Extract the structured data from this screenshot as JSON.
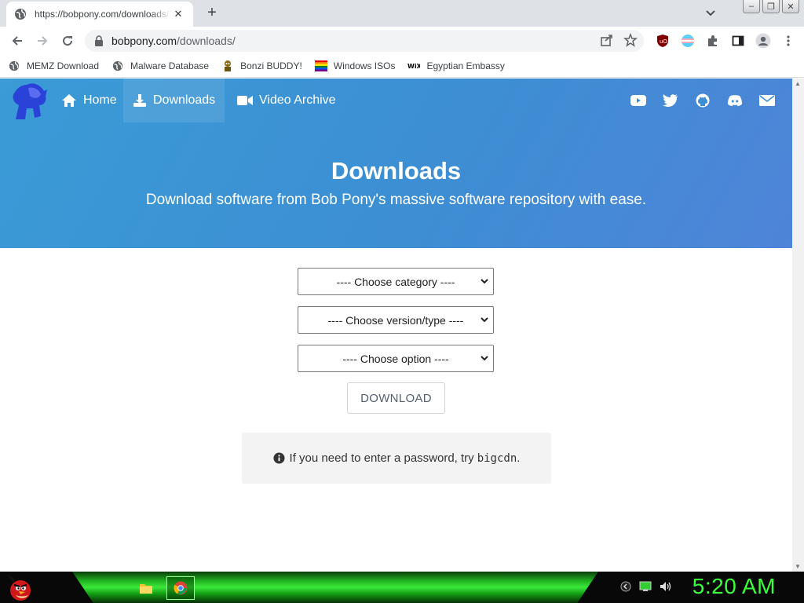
{
  "browser": {
    "tab_title": "https://bobpony.com/downloads/",
    "tab_close": "✕",
    "new_tab": "+",
    "url_host": "bobpony.com",
    "url_path": "/downloads/",
    "bookmarks": [
      {
        "label": "MEMZ Download",
        "icon": "globe-icon"
      },
      {
        "label": "Malware Database",
        "icon": "globe-icon"
      },
      {
        "label": "Bonzi BUDDY!",
        "icon": "bonzi-icon"
      },
      {
        "label": "Windows ISOs",
        "icon": "rainbow-flag-icon"
      },
      {
        "label": "Egyptian Embassy",
        "icon": "wix-icon"
      }
    ],
    "window_controls": [
      "–",
      "❐",
      "✕"
    ]
  },
  "site": {
    "nav": [
      {
        "label": "Home",
        "icon": "home-icon"
      },
      {
        "label": "Downloads",
        "icon": "download-icon",
        "active": true
      },
      {
        "label": "Video Archive",
        "icon": "video-icon"
      }
    ],
    "social_icons": [
      "youtube-icon",
      "twitter-icon",
      "github-icon",
      "discord-icon",
      "mail-icon"
    ],
    "hero_title": "Downloads",
    "hero_subtitle": "Download software from Bob Pony's massive software repository with ease.",
    "selects": {
      "category": "---- Choose category ----",
      "version": "---- Choose version/type ----",
      "option": "---- Choose option ----"
    },
    "download_button": "DOWNLOAD",
    "notice_text": "If you need to enter a password, try",
    "notice_code": "bigcdn",
    "notice_end": ".",
    "accent_color": "#3d8ed3"
  },
  "taskbar": {
    "apps": [
      "explorer-icon",
      "chrome-icon"
    ],
    "clock": "5:20 AM",
    "clock_color": "#3cff3c"
  }
}
